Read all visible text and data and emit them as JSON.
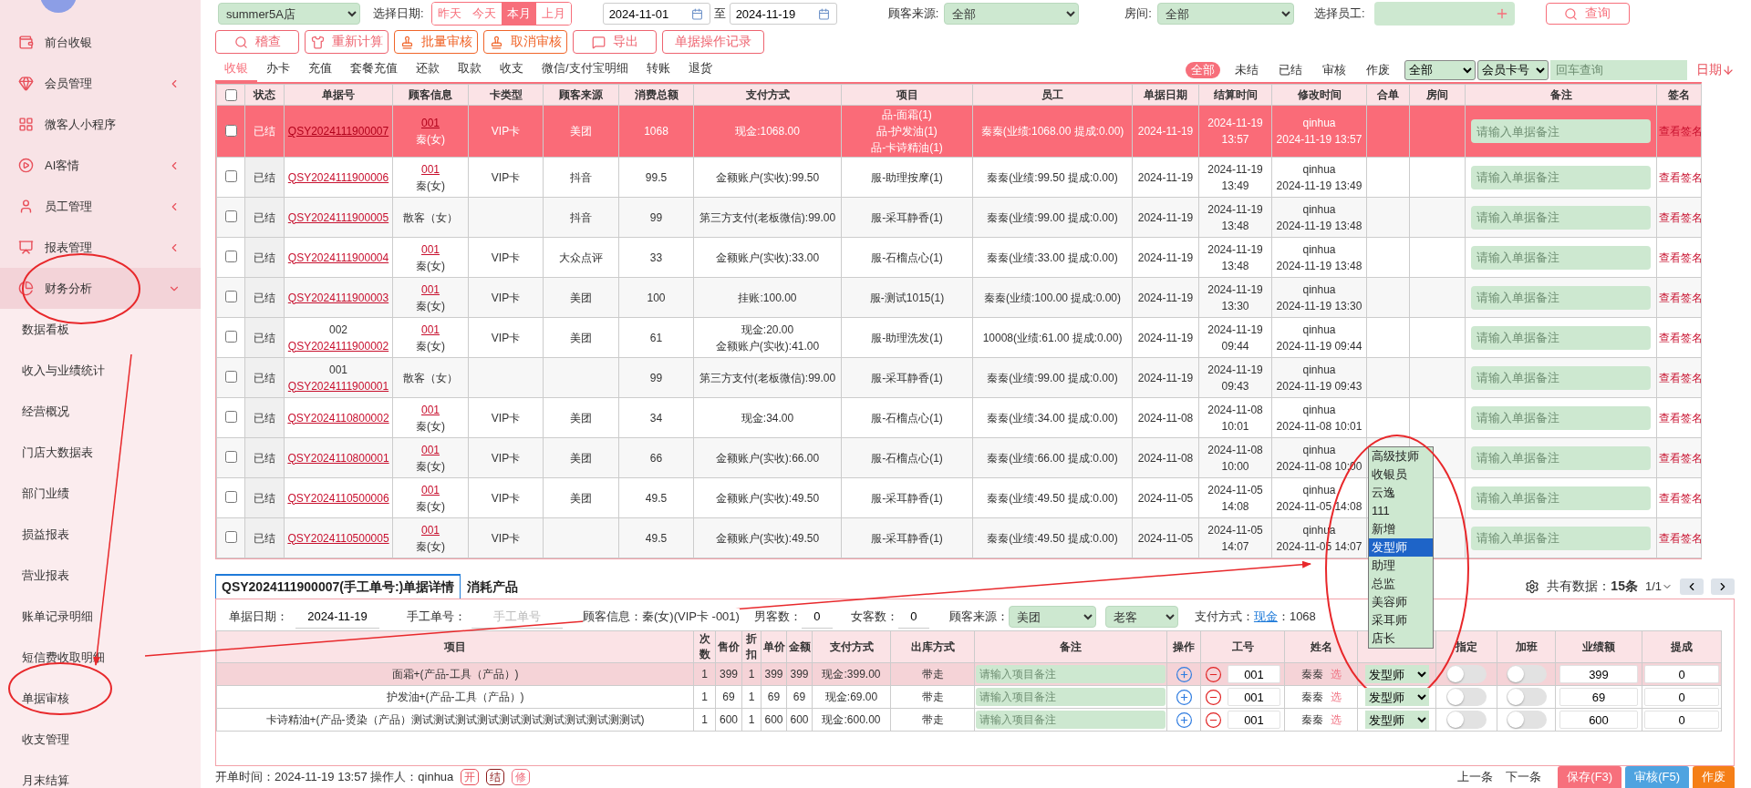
{
  "sidebar": {
    "items": [
      {
        "label": "前台收银",
        "kind": "link"
      },
      {
        "label": "会员管理",
        "kind": "group",
        "expanded": false
      },
      {
        "label": "微客人小程序",
        "kind": "link"
      },
      {
        "label": "AI客情",
        "kind": "group",
        "expanded": false
      },
      {
        "label": "员工管理",
        "kind": "group",
        "expanded": false
      },
      {
        "label": "报表管理",
        "kind": "group",
        "expanded": false
      },
      {
        "label": "财务分析",
        "kind": "group",
        "expanded": true,
        "children": [
          {
            "label": "数据看板"
          },
          {
            "label": "收入与业绩统计"
          },
          {
            "label": "经营概况"
          },
          {
            "label": "门店大数据表"
          },
          {
            "label": "部门业绩"
          },
          {
            "label": "损益报表"
          },
          {
            "label": "营业报表"
          },
          {
            "label": "账单记录明细"
          },
          {
            "label": "短信费收取明细"
          },
          {
            "label": "单据审核"
          },
          {
            "label": "收支管理"
          },
          {
            "label": "月末结算"
          }
        ]
      }
    ]
  },
  "filters": {
    "store": "summer5A店",
    "date_label": "选择日期:",
    "quick_dates": [
      {
        "label": "昨天",
        "selected": false
      },
      {
        "label": "今天",
        "selected": false
      },
      {
        "label": "本月",
        "selected": true
      },
      {
        "label": "上月",
        "selected": false
      }
    ],
    "date_from": "2024-11-01",
    "date_sep": "至",
    "date_to": "2024-11-19",
    "source_label": "顾客来源:",
    "source": "全部",
    "room_label": "房间:",
    "room": "全部",
    "staff_label": "选择员工:",
    "query_button": "查询"
  },
  "actions": [
    {
      "label": "稽查",
      "kind": "search"
    },
    {
      "label": "重新计算",
      "kind": "shirt"
    },
    {
      "label": "批量审核",
      "kind": "stamp"
    },
    {
      "label": "取消审核",
      "kind": "stamp"
    },
    {
      "label": "导出",
      "kind": "message"
    },
    {
      "label": "单据操作记录",
      "kind": "plain"
    }
  ],
  "tabs": [
    {
      "label": "收银",
      "selected": true
    },
    {
      "label": "办卡",
      "selected": false
    },
    {
      "label": "充值",
      "selected": false
    },
    {
      "label": "套餐充值",
      "selected": false
    },
    {
      "label": "还款",
      "selected": false
    },
    {
      "label": "取款",
      "selected": false
    },
    {
      "label": "收支",
      "selected": false
    },
    {
      "label": "微信/支付宝明细",
      "selected": false
    },
    {
      "label": "转账",
      "selected": false
    },
    {
      "label": "退货",
      "selected": false
    }
  ],
  "status_filters": [
    {
      "label": "全部",
      "selected": true
    },
    {
      "label": "未结",
      "selected": false
    },
    {
      "label": "已结",
      "selected": false
    },
    {
      "label": "审核",
      "selected": false
    },
    {
      "label": "作废",
      "selected": false
    }
  ],
  "status_select": "全部",
  "search_type": "会员卡号",
  "search": {
    "placeholder": "回车查询"
  },
  "sort_label": "日期",
  "table": {
    "header_checked": false,
    "columns": [
      "状态",
      "单据号",
      "顾客信息",
      "卡类型",
      "顾客来源",
      "消费总额",
      "支付方式",
      "项目",
      "员工",
      "单据日期",
      "结算时间",
      "修改时间",
      "合单",
      "房间",
      "备注",
      "签名"
    ],
    "rows": [
      {
        "selected": true,
        "checked": false,
        "status": "已结",
        "order_no": "QSY2024111900007",
        "customer_code": "001",
        "customer": "秦(女)",
        "card": "VIP卡",
        "source": "美团",
        "total": "1068",
        "payment": [
          "现金:1068.00"
        ],
        "items": [
          "品-面霜(1)",
          "品-护发油(1)",
          "品-卡诗精油(1)"
        ],
        "staff": "秦秦(业绩:1068.00 提成:0.00)",
        "date": "2024-11-19",
        "settle": [
          "2024-11-19",
          "13:57"
        ],
        "modified": [
          "qinhua",
          "2024-11-19 13:57"
        ],
        "note_placeholder": "请输入单据备注",
        "sign": "查看签名"
      },
      {
        "selected": false,
        "checked": false,
        "status": "已结",
        "order_no": "QSY2024111900006",
        "customer_code": "001",
        "customer": "秦(女)",
        "card": "VIP卡",
        "source": "抖音",
        "total": "99.5",
        "payment": [
          "金额账户(实收):99.50"
        ],
        "items": [
          "服-助理按摩(1)"
        ],
        "staff": "秦秦(业绩:99.50 提成:0.00)",
        "date": "2024-11-19",
        "settle": [
          "2024-11-19",
          "13:49"
        ],
        "modified": [
          "qinhua",
          "2024-11-19 13:49"
        ],
        "note_placeholder": "请输入单据备注",
        "sign": "查看签名"
      },
      {
        "selected": false,
        "checked": false,
        "status": "已结",
        "order_no": "QSY2024111900005",
        "customer": "散客（女）",
        "source": "抖音",
        "total": "99",
        "payment": [
          "第三方支付(老板微信):99.00"
        ],
        "items": [
          "服-采耳静香(1)"
        ],
        "staff": "秦秦(业绩:99.00 提成:0.00)",
        "date": "2024-11-19",
        "settle": [
          "2024-11-19",
          "13:48"
        ],
        "modified": [
          "qinhua",
          "2024-11-19 13:48"
        ],
        "note_placeholder": "请输入单据备注",
        "sign": "查看签名"
      },
      {
        "selected": false,
        "checked": false,
        "status": "已结",
        "order_no": "QSY2024111900004",
        "customer_code": "001",
        "customer": "秦(女)",
        "card": "VIP卡",
        "source": "大众点评",
        "total": "33",
        "payment": [
          "金额账户(实收):33.00"
        ],
        "items": [
          "服-石榴点心(1)"
        ],
        "staff": "秦秦(业绩:33.00 提成:0.00)",
        "date": "2024-11-19",
        "settle": [
          "2024-11-19",
          "13:48"
        ],
        "modified": [
          "qinhua",
          "2024-11-19 13:48"
        ],
        "note_placeholder": "请输入单据备注",
        "sign": "查看签名"
      },
      {
        "selected": false,
        "checked": false,
        "status": "已结",
        "order_no": "QSY2024111900003",
        "customer_code": "001",
        "customer": "秦(女)",
        "card": "VIP卡",
        "source": "美团",
        "total": "100",
        "payment": [
          "挂账:100.00"
        ],
        "items": [
          "服-测试1015(1)"
        ],
        "staff": "秦秦(业绩:100.00 提成:0.00)",
        "date": "2024-11-19",
        "settle": [
          "2024-11-19",
          "13:30"
        ],
        "modified": [
          "qinhua",
          "2024-11-19 13:30"
        ],
        "note_placeholder": "请输入单据备注",
        "sign": "查看签名"
      },
      {
        "selected": false,
        "checked": false,
        "status": "已结",
        "order_prefix": "002",
        "order_no": "QSY2024111900002",
        "customer_code": "001",
        "customer": "秦(女)",
        "card": "VIP卡",
        "source": "美团",
        "total": "61",
        "payment": [
          "现金:20.00",
          "金额账户(实收):41.00"
        ],
        "items": [
          "服-助理洗发(1)"
        ],
        "staff": "10008(业绩:61.00 提成:0.00)",
        "date": "2024-11-19",
        "settle": [
          "2024-11-19",
          "09:44"
        ],
        "modified": [
          "qinhua",
          "2024-11-19 09:44"
        ],
        "note_placeholder": "请输入单据备注",
        "sign": "查看签名"
      },
      {
        "selected": false,
        "checked": false,
        "status": "已结",
        "order_prefix": "001",
        "order_no": "QSY2024111900001",
        "customer": "散客（女）",
        "total": "99",
        "payment": [
          "第三方支付(老板微信):99.00"
        ],
        "items": [
          "服-采耳静香(1)"
        ],
        "staff": "秦秦(业绩:99.00 提成:0.00)",
        "date": "2024-11-19",
        "settle": [
          "2024-11-19",
          "09:43"
        ],
        "modified": [
          "qinhua",
          "2024-11-19 09:43"
        ],
        "note_placeholder": "请输入单据备注",
        "sign": "查看签名"
      },
      {
        "selected": false,
        "checked": false,
        "status": "已结",
        "order_no": "QSY2024110800002",
        "customer_code": "001",
        "customer": "秦(女)",
        "card": "VIP卡",
        "source": "美团",
        "total": "34",
        "payment": [
          "现金:34.00"
        ],
        "items": [
          "服-石榴点心(1)"
        ],
        "staff": "秦秦(业绩:34.00 提成:0.00)",
        "date": "2024-11-08",
        "settle": [
          "2024-11-08",
          "10:01"
        ],
        "modified": [
          "qinhua",
          "2024-11-08 10:01"
        ],
        "note_placeholder": "请输入单据备注",
        "sign": "查看签名"
      },
      {
        "selected": false,
        "checked": false,
        "status": "已结",
        "order_no": "QSY2024110800001",
        "customer_code": "001",
        "customer": "秦(女)",
        "card": "VIP卡",
        "source": "美团",
        "total": "66",
        "payment": [
          "金额账户(实收):66.00"
        ],
        "items": [
          "服-石榴点心(1)"
        ],
        "staff": "秦秦(业绩:66.00 提成:0.00)",
        "date": "2024-11-08",
        "settle": [
          "2024-11-08",
          "10:00"
        ],
        "modified": [
          "qinhua",
          "2024-11-08 10:00"
        ],
        "note_placeholder": "请输入单据备注",
        "sign": "查看签名"
      },
      {
        "selected": false,
        "checked": false,
        "status": "已结",
        "order_no": "QSY2024110500006",
        "customer_code": "001",
        "customer": "秦(女)",
        "card": "VIP卡",
        "source": "美团",
        "total": "49.5",
        "payment": [
          "金额账户(实收):49.50"
        ],
        "items": [
          "服-采耳静香(1)"
        ],
        "staff": "秦秦(业绩:49.50 提成:0.00)",
        "date": "2024-11-05",
        "settle": [
          "2024-11-05",
          "14:08"
        ],
        "modified": [
          "qinhua",
          "2024-11-05 14:08"
        ],
        "note_placeholder": "请输入单据备注",
        "sign": "查看签名"
      },
      {
        "selected": false,
        "checked": false,
        "status": "已结",
        "order_no": "QSY2024110500005",
        "customer_code": "001",
        "customer": "秦(女)",
        "card": "VIP卡",
        "total": "49.5",
        "payment": [
          "金额账户(实收):49.50"
        ],
        "items": [
          "服-采耳静香(1)"
        ],
        "staff": "秦秦(业绩:49.50 提成:0.00)",
        "date": "2024-11-05",
        "settle": [
          "2024-11-05",
          "14:07"
        ],
        "modified": [
          "qinhua",
          "2024-11-05 14:07"
        ],
        "note_placeholder": "请输入单据备注",
        "sign": "查看签名"
      }
    ]
  },
  "detail": {
    "tabs": [
      {
        "label": "QSY2024111900007(手工单号:)单据详情",
        "selected": true
      },
      {
        "label": "消耗产品",
        "selected": false
      }
    ],
    "pagination": {
      "total": "共有数据：**15条**",
      "page": "1/1"
    },
    "info": {
      "date_label": "单据日期：",
      "date": "2024-11-19",
      "manual_label": "手工单号：",
      "manual_placeholder": "手工单号",
      "customer": "顾客信息：秦(女)(VIP卡 -001)",
      "male_label": "男客数：",
      "male": "0",
      "female_label": "女客数：",
      "female": "0",
      "source_label": "顾客来源：",
      "source": "美团",
      "customer_type": "老客",
      "pay_label": "支付方式：",
      "pay_link": "现金",
      "pay_amount": "：1068"
    },
    "columns": [
      "项目",
      "次数",
      "售价",
      "折扣",
      "单价",
      "金额",
      "支付方式",
      "出库方式",
      "备注",
      "操作",
      "工号",
      "姓名"
    ],
    "columns_right": [
      "指定",
      "加班",
      "业绩额",
      "提成"
    ],
    "rows": [
      {
        "selected": true,
        "item": "面霜+(产品-工具（产品）)",
        "count": "1",
        "price": "399",
        "discount": "1",
        "unit_price": "399",
        "amount": "399",
        "payment": "现金:399.00",
        "delivery": "带走",
        "note_placeholder": "请输入项目备注",
        "staff_no": "001",
        "staff_name": "秦秦",
        "pick": "选",
        "role": "发型师",
        "assigned": false,
        "overtime": false,
        "performance": "399",
        "commission": "0"
      },
      {
        "selected": false,
        "item": "护发油+(产品-工具（产品）)",
        "count": "1",
        "price": "69",
        "discount": "1",
        "unit_price": "69",
        "amount": "69",
        "payment": "现金:69.00",
        "delivery": "带走",
        "note_placeholder": "请输入项目备注",
        "staff_no": "001",
        "staff_name": "秦秦",
        "pick": "选",
        "role": "发型师",
        "assigned": false,
        "overtime": false,
        "performance": "69",
        "commission": "0"
      },
      {
        "selected": false,
        "item": "卡诗精油+(产品-烫染（产品）测试测试测试测试测试测试测试测试测试测测试)",
        "count": "1",
        "price": "600",
        "discount": "1",
        "unit_price": "600",
        "amount": "600",
        "payment": "现金:600.00",
        "delivery": "带走",
        "note_placeholder": "请输入项目备注",
        "staff_no": "001",
        "staff_name": "秦秦",
        "pick": "选",
        "role": "发型师",
        "assigned": false,
        "overtime": false,
        "performance": "600",
        "commission": "0"
      }
    ]
  },
  "role_dropdown": {
    "options": [
      {
        "label": "高级技师",
        "selected": false
      },
      {
        "label": "收银员",
        "selected": false
      },
      {
        "label": "云逸",
        "selected": false
      },
      {
        "label": "111",
        "selected": false
      },
      {
        "label": "新增",
        "selected": false
      },
      {
        "label": "发型师",
        "selected": true
      },
      {
        "label": "助理",
        "selected": false
      },
      {
        "label": "总监",
        "selected": false
      },
      {
        "label": "美容师",
        "selected": false
      },
      {
        "label": "采耳师",
        "selected": false
      },
      {
        "label": "店长",
        "selected": false
      }
    ]
  },
  "footer": {
    "info": "开单时间：2024-11-19 13:57 操作人：qinhua",
    "stamps": [
      {
        "label": "开",
        "color": "#e8505b"
      },
      {
        "label": "结",
        "color": "#8b1a1a"
      },
      {
        "label": "修",
        "color": "#f07080"
      }
    ],
    "nav": [
      "上一条",
      "下一条"
    ],
    "buttons": [
      {
        "label": "保存(F3)",
        "kind": "save"
      },
      {
        "label": "审核(F5)",
        "kind": "audit"
      },
      {
        "label": "作废",
        "kind": "void"
      }
    ]
  }
}
